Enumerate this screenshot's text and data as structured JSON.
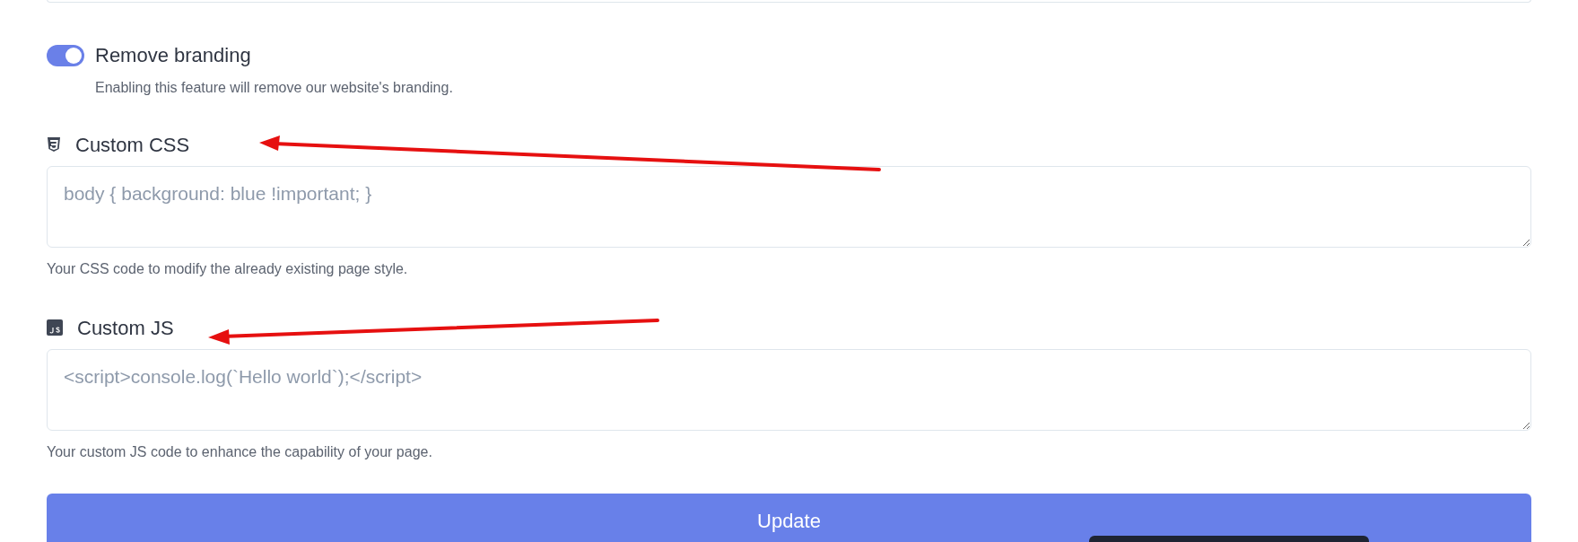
{
  "branding": {
    "label": "Remove branding",
    "on": true,
    "description": "Enabling this feature will remove our website's branding."
  },
  "fields": [
    {
      "kind": "css",
      "label": "Custom CSS",
      "placeholder": "body { background: blue !important; }",
      "help": "Your CSS code to modify the already existing page style."
    },
    {
      "kind": "js",
      "label": "Custom JS",
      "placeholder": "<script>console.log(`Hello world`);</script>",
      "help": "Your custom JS code to enhance the capability of your page."
    }
  ],
  "submit": {
    "label": "Update"
  }
}
